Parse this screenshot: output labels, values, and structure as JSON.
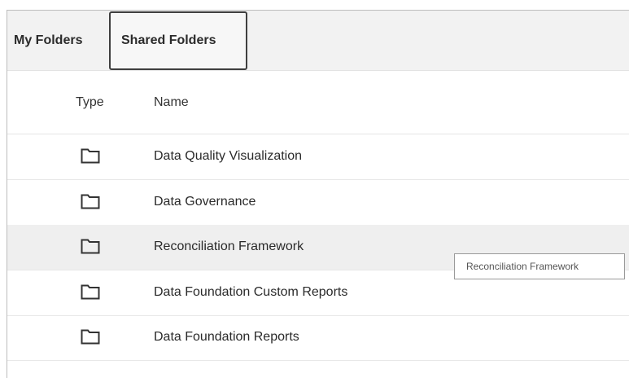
{
  "tabs": [
    {
      "label": "My Folders",
      "active": false
    },
    {
      "label": "Shared Folders",
      "active": true
    }
  ],
  "columns": {
    "type": "Type",
    "name": "Name"
  },
  "rows": [
    {
      "type_icon": "folder-icon",
      "name": "Data Quality Visualization"
    },
    {
      "type_icon": "folder-icon",
      "name": "Data Governance"
    },
    {
      "type_icon": "folder-icon",
      "name": "Reconciliation Framework"
    },
    {
      "type_icon": "folder-icon",
      "name": "Data Foundation Custom Reports"
    },
    {
      "type_icon": "folder-icon",
      "name": "Data Foundation Reports"
    }
  ],
  "tooltip": {
    "text": "Reconciliation Framework"
  },
  "colors": {
    "hover_row": "#efefef",
    "tab_bar": "#f2f2f2",
    "active_tab_border": "#3f3f3f"
  }
}
